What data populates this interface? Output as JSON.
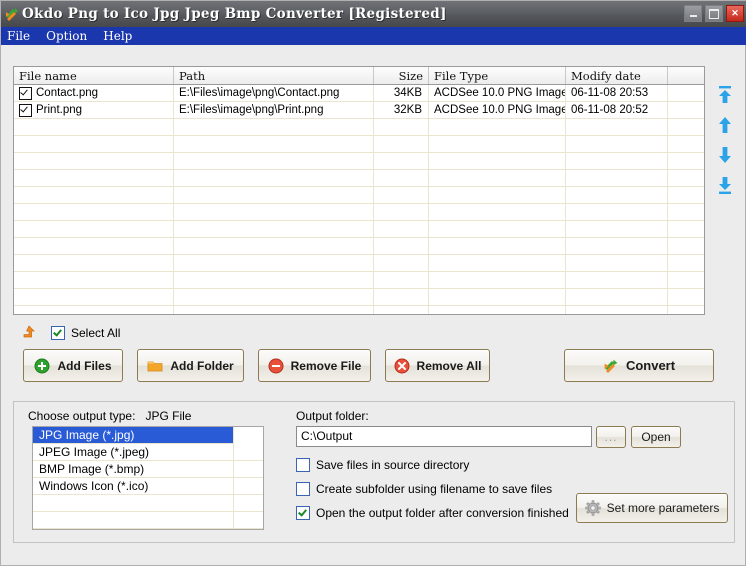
{
  "window": {
    "title": "Okdo Png to Ico Jpg Jpeg Bmp Converter [Registered]",
    "app_icon": "convert-arrows-icon",
    "minimize_label": "Minimize",
    "maximize_label": "Maximize",
    "close_label": "✕"
  },
  "menubar": {
    "items": [
      {
        "label": "File"
      },
      {
        "label": "Option"
      },
      {
        "label": "Help"
      }
    ]
  },
  "filelist": {
    "columns": [
      {
        "key": "name",
        "label": "File name"
      },
      {
        "key": "path",
        "label": "Path"
      },
      {
        "key": "size",
        "label": "Size"
      },
      {
        "key": "type",
        "label": "File Type"
      },
      {
        "key": "date",
        "label": "Modify date"
      },
      {
        "key": "extra",
        "label": ""
      }
    ],
    "rows": [
      {
        "checked": true,
        "name": "Contact.png",
        "path": "E:\\Files\\image\\png\\Contact.png",
        "size": "34KB",
        "type": "ACDSee 10.0 PNG Image",
        "date": "06-11-08 20:53",
        "extra": ""
      },
      {
        "checked": true,
        "name": "Print.png",
        "path": "E:\\Files\\image\\png\\Print.png",
        "size": "32KB",
        "type": "ACDSee 10.0 PNG Image",
        "date": "06-11-08 20:52",
        "extra": ""
      }
    ],
    "empty_row_count": 12
  },
  "order_buttons": [
    {
      "name": "move-to-top-button",
      "title": "Move to top"
    },
    {
      "name": "move-up-button",
      "title": "Move up"
    },
    {
      "name": "move-down-button",
      "title": "Move down"
    },
    {
      "name": "move-to-bottom-button",
      "title": "Move to bottom"
    }
  ],
  "toolbar": {
    "up_icon": "parent-folder-arrow-icon",
    "select_all_label": "Select All",
    "select_all_checked": true,
    "add_files_label": "Add Files",
    "add_folder_label": "Add Folder",
    "remove_file_label": "Remove File",
    "remove_all_label": "Remove All",
    "convert_label": "Convert"
  },
  "output": {
    "choose_type_label": "Choose output type:",
    "choose_type_value": "JPG File",
    "type_options": [
      {
        "label": "JPG Image (*.jpg)",
        "selected": true
      },
      {
        "label": "JPEG Image (*.jpeg)",
        "selected": false
      },
      {
        "label": "BMP Image (*.bmp)",
        "selected": false
      },
      {
        "label": "Windows Icon (*.ico)",
        "selected": false
      }
    ],
    "folder_label": "Output folder:",
    "folder_value": "C:\\Output",
    "browse_label": "...",
    "open_label": "Open",
    "option_save_in_source": {
      "label": "Save files in source directory",
      "checked": false
    },
    "option_create_subfolder": {
      "label": "Create subfolder using filename to save files",
      "checked": false
    },
    "option_open_after": {
      "label": "Open the output folder after conversion finished",
      "checked": true
    },
    "set_parameters_label": "Set more parameters"
  },
  "colors": {
    "titlebar": "#5c5f63",
    "menubar": "#1b37ae",
    "selection": "#2a5bd7",
    "window_bg": "#ececec",
    "grid_line": "#ebe4cf",
    "button_border": "#8b7a52",
    "accent_orange": "#f08a24",
    "accent_green": "#2fa12f",
    "accent_red": "#e0432c",
    "arrow_blue": "#2aa3e8"
  }
}
